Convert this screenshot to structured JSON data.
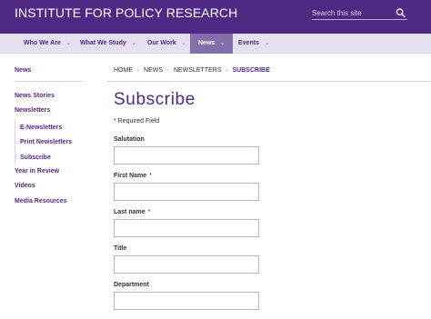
{
  "header": {
    "site_title": "INSTITUTE FOR POLICY RESEARCH",
    "search_placeholder": "Search this site",
    "search_icon": "search-icon"
  },
  "nav": {
    "items": [
      {
        "label": "Who We Are",
        "chevron": "⌄"
      },
      {
        "label": "What We Study",
        "chevron": "⌄"
      },
      {
        "label": "Our Work",
        "chevron": "⌄"
      },
      {
        "label": "News",
        "chevron": "⌄"
      },
      {
        "label": "Events",
        "chevron": "⌄"
      }
    ],
    "active": "News"
  },
  "sidebar": {
    "top": "News",
    "items": [
      {
        "label": "News Stories"
      },
      {
        "label": "Newsletters"
      },
      {
        "label": "E-Newsletters"
      },
      {
        "label": "Print Newsletters"
      },
      {
        "label": "Subscribe"
      },
      {
        "label": "Year in Review"
      },
      {
        "label": "Videos"
      },
      {
        "label": "Media Resources"
      }
    ]
  },
  "breadcrumb": {
    "items": [
      "HOME",
      "NEWS",
      "NEWSLETTERS",
      "SUBSCRIBE"
    ],
    "separator": "›"
  },
  "page": {
    "title": "Subscribe",
    "required_note": "* Required Field"
  },
  "form": {
    "fields": [
      {
        "label": "Salutation",
        "required_mark": "",
        "value": ""
      },
      {
        "label": "First Name",
        "required_mark": "*",
        "value": ""
      },
      {
        "label": "Last name",
        "required_mark": "*",
        "value": ""
      },
      {
        "label": "Title",
        "required_mark": "",
        "value": ""
      },
      {
        "label": "Department",
        "required_mark": "",
        "value": ""
      }
    ]
  },
  "colors": {
    "brand_purple": "#4e2a84",
    "nav_bg": "#e4e0ee",
    "nav_active": "#836eaa"
  }
}
